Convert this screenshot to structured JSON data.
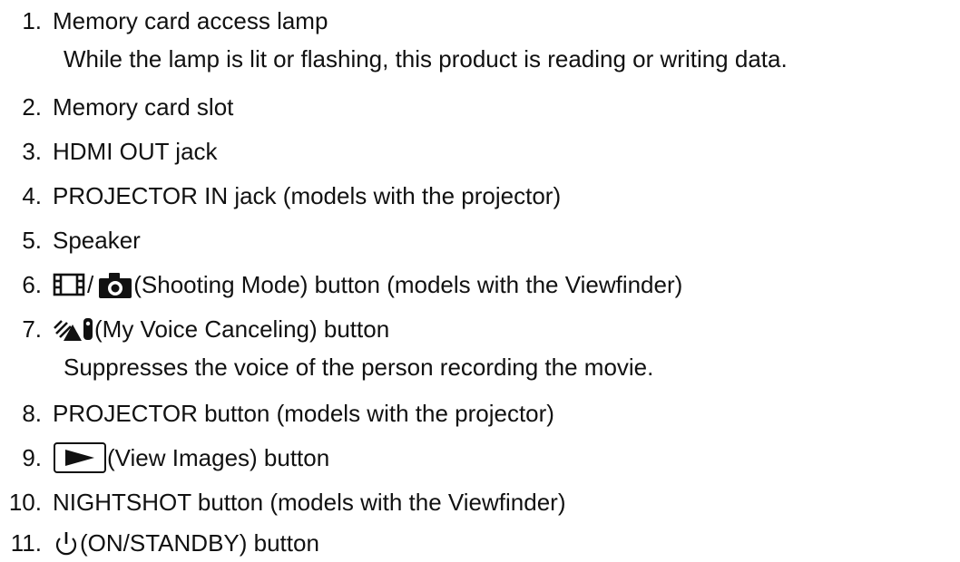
{
  "items": [
    {
      "num": "1.",
      "label": "Memory card access lamp",
      "desc": "While the lamp is lit or flashing, this product is reading or writing data."
    },
    {
      "num": "2.",
      "label": "Memory card slot"
    },
    {
      "num": "3.",
      "label": "HDMI OUT jack"
    },
    {
      "num": "4.",
      "label": "PROJECTOR IN jack (models with the projector)"
    },
    {
      "num": "5.",
      "label": "Speaker"
    },
    {
      "num": "6.",
      "slash": "/",
      "label": "(Shooting Mode) button (models with the Viewfinder)",
      "icons": [
        "film-icon",
        "camera-icon"
      ]
    },
    {
      "num": "7.",
      "label": "(My Voice Canceling) button",
      "desc": "Suppresses the voice of the person recording the movie.",
      "icons": [
        "my-voice-canceling-icon"
      ]
    },
    {
      "num": "8.",
      "label": "PROJECTOR button (models with the projector)"
    },
    {
      "num": "9.",
      "label": "(View Images) button",
      "icons": [
        "play-icon"
      ]
    },
    {
      "num": "10.",
      "label": "NIGHTSHOT button (models with the Viewfinder)"
    },
    {
      "num": "11.",
      "label": "(ON/STANDBY) button",
      "icons": [
        "power-icon"
      ]
    }
  ]
}
